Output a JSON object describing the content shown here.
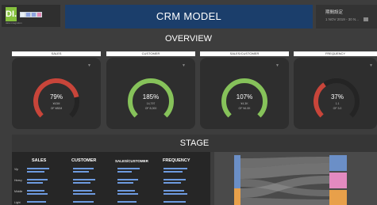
{
  "header": {
    "logo_text": "DI.",
    "logo_sub": "data integration",
    "chips": [
      "#e9f0f5",
      "#8ea4e0",
      "#e58ab5"
    ],
    "title": "CRM MODEL",
    "date_label": "期間設定",
    "date_value": "1 NOV 2019 - 30 N..."
  },
  "overview": {
    "title": "OVERVIEW",
    "kpis": [
      {
        "header": "SALES",
        "main": "79%",
        "sub1": "¥43M",
        "sub2": "OF ¥80M",
        "percent": 79,
        "color": "#c8453a"
      },
      {
        "header": "CUSTOMER",
        "main": "185%",
        "sub1": "14,797",
        "sub2": "OF 8,000",
        "percent": 100,
        "color": "#86c25a"
      },
      {
        "header": "SALES/CUSTOMER",
        "main": "107%",
        "sub1": "¥4.3K",
        "sub2": "OF ¥4.0K",
        "percent": 100,
        "color": "#86c25a"
      },
      {
        "header": "FREQUENCY",
        "main": "37%",
        "sub1": "1.1",
        "sub2": "OF 3.0",
        "percent": 37,
        "color": "#c8453a"
      }
    ]
  },
  "stage": {
    "title": "STAGE",
    "columns": [
      "SALES",
      "CUSTOMER",
      "SALES/CUSTOMER",
      "FREQUENCY"
    ],
    "rows": [
      "Vip",
      "Heavy",
      "Middle",
      "Light"
    ]
  },
  "colors": {
    "bg": "#3d3d3d",
    "card": "#2e2e2e",
    "title_bar": "#1b3e6b",
    "accent_green": "#86c25a",
    "accent_red": "#c8453a",
    "table_bar": "#6e9be0",
    "flow_blue": "#6b8fc7",
    "flow_orange": "#e8a04a",
    "flow_pink": "#e38ac0"
  }
}
